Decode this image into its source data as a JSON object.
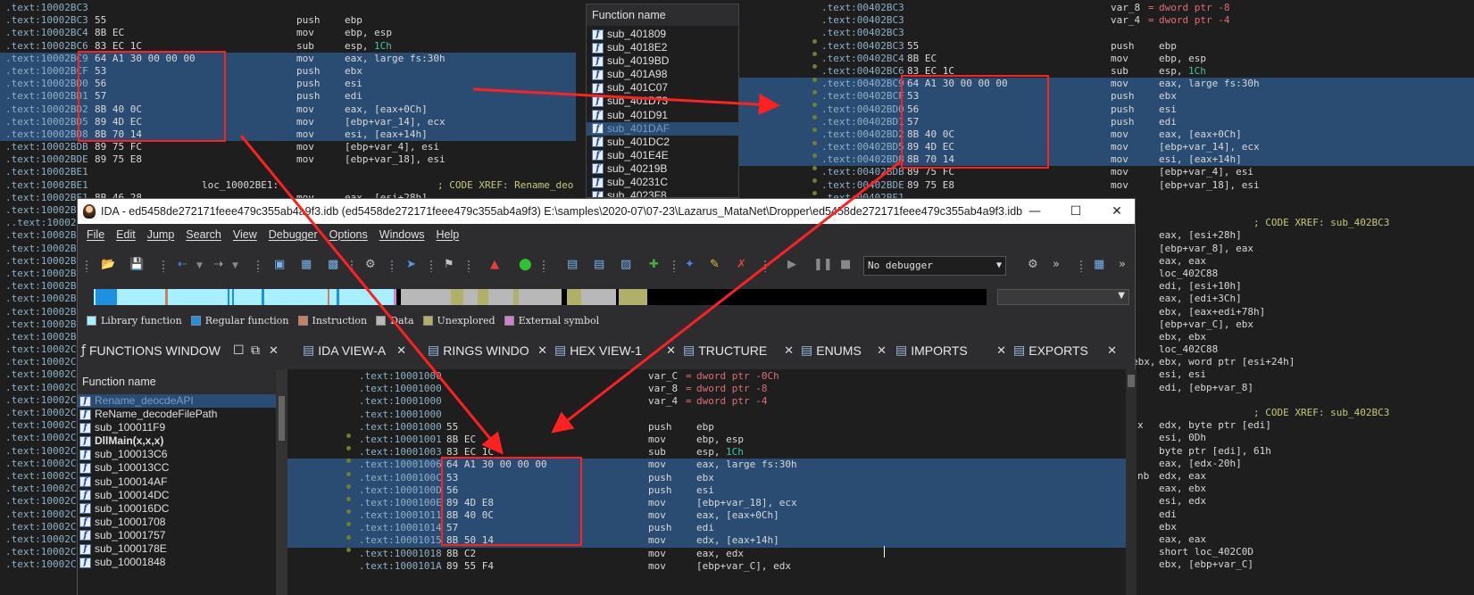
{
  "top_left": {
    "lines": [
      {
        "a": ".text:10002BC3",
        "b": "",
        "m": "",
        "o": ""
      },
      {
        "a": ".text:10002BC3",
        "b": "55",
        "m": "push",
        "o": "ebp"
      },
      {
        "a": ".text:10002BC4",
        "b": "8B EC",
        "m": "mov",
        "o": "ebp, esp"
      },
      {
        "a": ".text:10002BC6",
        "b": "83 EC 1C",
        "m": "sub",
        "o": "esp, ",
        "n": "1Ch"
      },
      {
        "a": ".text:10002BC9",
        "b": "64 A1 30 00 00 00",
        "m": "mov",
        "o": "eax, large fs:30h",
        "s": 1
      },
      {
        "a": ".text:10002BCF",
        "b": "53",
        "m": "push",
        "o": "ebx",
        "s": 1
      },
      {
        "a": ".text:10002BD0",
        "b": "56",
        "m": "push",
        "o": "esi",
        "s": 1
      },
      {
        "a": ".text:10002BD1",
        "b": "57",
        "m": "push",
        "o": "edi",
        "s": 1
      },
      {
        "a": ".text:10002BD2",
        "b": "8B 40 0C",
        "m": "mov",
        "o": "eax, [eax+0Ch]",
        "s": 1
      },
      {
        "a": ".text:10002BD5",
        "b": "89 4D EC",
        "m": "mov",
        "o": "[ebp+var_14], ecx",
        "s": 1
      },
      {
        "a": ".text:10002BD8",
        "b": "8B 70 14",
        "m": "mov",
        "o": "esi, [eax+14h]",
        "s": 1
      },
      {
        "a": ".text:10002BDB",
        "b": "89 75 FC",
        "m": "mov",
        "o": "[ebp+var_4], esi"
      },
      {
        "a": ".text:10002BDE",
        "b": "89 75 E8",
        "m": "mov",
        "o": "[ebp+var_18], esi"
      },
      {
        "a": ".text:10002BE1",
        "b": "",
        "m": "",
        "o": ""
      },
      {
        "a": ".text:10002BE1",
        "b": "",
        "l": "loc_10002BE1:",
        "m": "",
        "o": "",
        "c": "; CODE XREF: Rename_deo"
      },
      {
        "a": ".text:10002BE1",
        "b": "8B 46 28",
        "m": "mov",
        "o": "eax, [esi+28h]"
      }
    ],
    "left_col": [
      ".text:10002BE",
      "..text:10002BE",
      ".text:10002BE",
      ".text:10002BE",
      ".text:10002BE",
      ".text:10002BE",
      ".text:10002BE",
      ".text:10002BE",
      ".text:10002BF",
      ".text:10002BF",
      ".text:10002BF",
      ".text:10002C0",
      ".text:10002C0",
      ".text:10002C0",
      ".text:10002C0",
      ".text:10002C0",
      ".text:10002C0",
      ".text:10002C0",
      ".text:10002C0",
      ".text:10002C1",
      ".text:10002C1",
      ".text:10002C1",
      ".text:10002C1",
      ".text:10002C1",
      ".text:10002C1",
      ".text:10002C1",
      ".text:10002C2",
      ".text:10002C2",
      ".text:10002C2"
    ]
  },
  "func_popup": {
    "header": "Function name",
    "items": [
      "sub_401809",
      "sub_4018E2",
      "sub_4019BD",
      "sub_401A98",
      "sub_401C07",
      "sub_401D73",
      "sub_401D91",
      "sub_401DAF",
      "sub_401DC2",
      "sub_401E4E",
      "sub_40219B",
      "sub_40231C",
      "sub_4023F8"
    ],
    "selected": 7
  },
  "top_right": {
    "lines": [
      {
        "a": ".text:00402BC3",
        "b": "",
        "v": "var_8",
        "eq": "=",
        "t": "dword ptr -8"
      },
      {
        "a": ".text:00402BC3",
        "b": "",
        "v": "var_4",
        "eq": "=",
        "t": "dword ptr -4"
      },
      {
        "a": ".text:00402BC3",
        "b": "",
        "m": "",
        "o": ""
      },
      {
        "a": ".text:00402BC3",
        "b": "55",
        "m": "push",
        "o": "ebp"
      },
      {
        "a": ".text:00402BC4",
        "b": "8B EC",
        "m": "mov",
        "o": "ebp, esp"
      },
      {
        "a": ".text:00402BC6",
        "b": "83 EC 1C",
        "m": "sub",
        "o": "esp, ",
        "n": "1Ch"
      },
      {
        "a": ".text:00402BC9",
        "b": "64 A1 30 00 00 00",
        "m": "mov",
        "o": "eax, large fs:30h",
        "s": 1
      },
      {
        "a": ".text:00402BCF",
        "b": "53",
        "m": "push",
        "o": "ebx",
        "s": 1
      },
      {
        "a": ".text:00402BD0",
        "b": "56",
        "m": "push",
        "o": "esi",
        "s": 1
      },
      {
        "a": ".text:00402BD1",
        "b": "57",
        "m": "push",
        "o": "edi",
        "s": 1
      },
      {
        "a": ".text:00402BD2",
        "b": "8B 40 0C",
        "m": "mov",
        "o": "eax, [eax+0Ch]",
        "s": 1
      },
      {
        "a": ".text:00402BD5",
        "b": "89 4D EC",
        "m": "mov",
        "o": "[ebp+var_14], ecx",
        "s": 1
      },
      {
        "a": ".text:00402BD8",
        "b": "8B 70 14",
        "m": "mov",
        "o": "esi, [eax+14h]",
        "s": 1
      },
      {
        "a": ".text:00402BDB",
        "b": "89 75 FC",
        "m": "mov",
        "o": "[ebp+var_4], esi"
      },
      {
        "a": ".text:00402BDE",
        "b": "89 75 E8",
        "m": "mov",
        "o": "[ebp+var_18], esi"
      },
      {
        "a": ".text:00402BE1",
        "b": "",
        "m": "",
        "o": ""
      }
    ],
    "right_col": [
      {
        "o": ""
      },
      {
        "o": "",
        "c": "; CODE XREF: sub_402BC3"
      },
      {
        "o": "eax, [esi+28h]"
      },
      {
        "o": "[ebp+var_8], eax"
      },
      {
        "o": "eax, eax"
      },
      {
        "o": "loc_402C88"
      },
      {
        "o": "edi, [esi+10h]"
      },
      {
        "o": "eax, [edi+3Ch]"
      },
      {
        "o": "ebx, [eax+edi+78h]"
      },
      {
        "o": "[ebp+var_C], ebx"
      },
      {
        "o": "ebx, ebx"
      },
      {
        "o": "loc_402C88"
      },
      {
        "o": "ebx, word ptr [esi+24h]",
        "p": "ebx,"
      },
      {
        "o": "esi, esi"
      },
      {
        "o": "edi, [ebp+var_8]"
      },
      {
        "o": ""
      },
      {
        "o": "",
        "c": "; CODE XREF: sub_402BC3"
      },
      {
        "o": "edx, byte ptr [edi]",
        "p": "x"
      },
      {
        "o": "esi, 0Dh"
      },
      {
        "o": "byte ptr [edi], 61h"
      },
      {
        "o": "eax, [edx-20h]"
      },
      {
        "o": "edx, eax",
        "p": "nb"
      },
      {
        "o": "eax, ebx"
      },
      {
        "o": "esi, edx"
      },
      {
        "o": "edi"
      },
      {
        "o": "ebx"
      },
      {
        "o": "eax, eax"
      },
      {
        "o": "short loc_402C0D"
      },
      {
        "o": "ebx, [ebp+var_C]"
      }
    ]
  },
  "ida": {
    "title": "IDA - ed5458de272171feee479c355ab4a9f3.idb (ed5458de272171feee479c355ab4a9f3) E:\\samples\\2020-07\\07-23\\Lazarus_MataNet\\Dropper\\ed5458de272171feee479c355ab4a9f3.idb",
    "menu": [
      "File",
      "Edit",
      "Jump",
      "Search",
      "View",
      "Debugger",
      "Options",
      "Windows",
      "Help"
    ],
    "debugger": "No debugger",
    "legend": [
      "Library function",
      "Regular function",
      "Instruction",
      "Data",
      "Unexplored",
      "External symbol"
    ],
    "legend_colors": [
      "#a8f0ff",
      "#1e90e0",
      "#c88060",
      "#b8b8b8",
      "#b0b068",
      "#d080d0"
    ],
    "tabs": [
      "FUNCTIONS WINDOW",
      "IDA VIEW-A",
      "RINGS WINDO",
      "HEX VIEW-1",
      "TRUCTURE",
      "ENUMS",
      "IMPORTS",
      "EXPORTS"
    ],
    "fn_header": "Function name",
    "functions": [
      "Rename_deocdeAPI",
      "ReName_decodeFilePath",
      "sub_100011F9",
      "DllMain(x,x,x)",
      "sub_100013C6",
      "sub_100013CC",
      "sub_100014AF",
      "sub_100014DC",
      "sub_100016DC",
      "sub_10001708",
      "sub_10001757",
      "sub_1000178E",
      "sub_10001848"
    ],
    "fn_selected": 0,
    "fn_bold": 3,
    "code": [
      {
        "a": ".text:10001000",
        "b": "",
        "v": "var_C",
        "eq": "=",
        "t": "dword ptr -0Ch"
      },
      {
        "a": ".text:10001000",
        "b": "",
        "v": "var_8",
        "eq": "=",
        "t": "dword ptr -8"
      },
      {
        "a": ".text:10001000",
        "b": "",
        "v": "var_4",
        "eq": "=",
        "t": "dword ptr -4"
      },
      {
        "a": ".text:10001000",
        "b": "",
        "m": "",
        "o": ""
      },
      {
        "a": ".text:10001000",
        "b": "55",
        "m": "push",
        "o": "ebp"
      },
      {
        "a": ".text:10001001",
        "b": "8B EC",
        "m": "mov",
        "o": "ebp, esp"
      },
      {
        "a": ".text:10001003",
        "b": "83 EC 1C",
        "m": "sub",
        "o": "esp, ",
        "n": "1Ch"
      },
      {
        "a": ".text:10001006",
        "b": "64 A1 30 00 00 00",
        "m": "mov",
        "o": "eax, large fs:30h",
        "s": 1
      },
      {
        "a": ".text:1000100C",
        "b": "53",
        "m": "push",
        "o": "ebx",
        "s": 1
      },
      {
        "a": ".text:1000100D",
        "b": "56",
        "m": "push",
        "o": "esi",
        "s": 1
      },
      {
        "a": ".text:1000100E",
        "b": "89 4D E8",
        "m": "mov",
        "o": "[ebp+var_18], ecx",
        "s": 1
      },
      {
        "a": ".text:10001011",
        "b": "8B 40 0C",
        "m": "mov",
        "o": "eax, [eax+0Ch]",
        "s": 1
      },
      {
        "a": ".text:10001014",
        "b": "57",
        "m": "push",
        "o": "edi",
        "s": 1
      },
      {
        "a": ".text:10001015",
        "b": "8B 50 14",
        "m": "mov",
        "o": "edx, [eax+14h]",
        "s": 1
      },
      {
        "a": ".text:10001018",
        "b": "8B C2",
        "m": "mov",
        "o": "eax, edx"
      },
      {
        "a": ".text:1000101A",
        "b": "89 55 F4",
        "m": "mov",
        "o": "[ebp+var_C], edx"
      }
    ]
  }
}
